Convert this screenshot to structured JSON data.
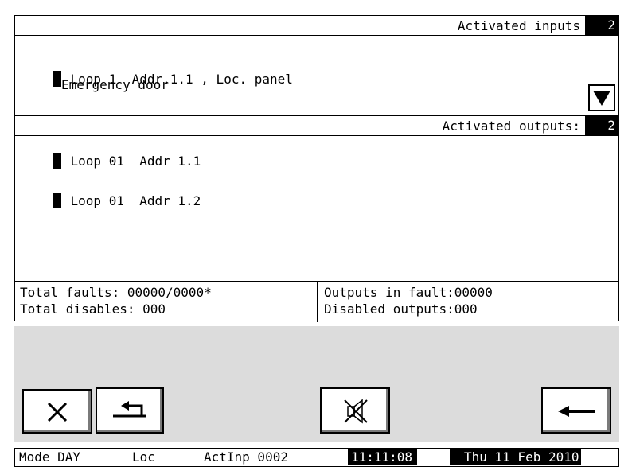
{
  "inputs": {
    "title": "Activated inputs",
    "count": "2",
    "items": [
      {
        "line1": "Loop 1  Addr.1.1 , Loc. panel",
        "line2": "Emergency door"
      }
    ]
  },
  "outputs": {
    "title": "Activated outputs:",
    "count": "2",
    "items": [
      {
        "label": "Loop 01  Addr 1.1"
      },
      {
        "label": "Loop 01  Addr 1.2"
      }
    ]
  },
  "stats": {
    "total_faults": "Total faults: 00000/0000*",
    "total_disables": "Total disables: 000",
    "outputs_in_fault": "Outputs in fault:00000",
    "disabled_outputs": "Disabled outputs:000"
  },
  "buttons": {
    "close": "close-icon",
    "back": "return-icon",
    "mute": "sound-mute-icon",
    "enter": "arrow-left-icon"
  },
  "statusbar": {
    "mode": "Mode DAY",
    "loc": "Loc",
    "actinp": "ActInp 0002",
    "time": "11:11:08",
    "date": "Thu 11 Feb 2010"
  }
}
